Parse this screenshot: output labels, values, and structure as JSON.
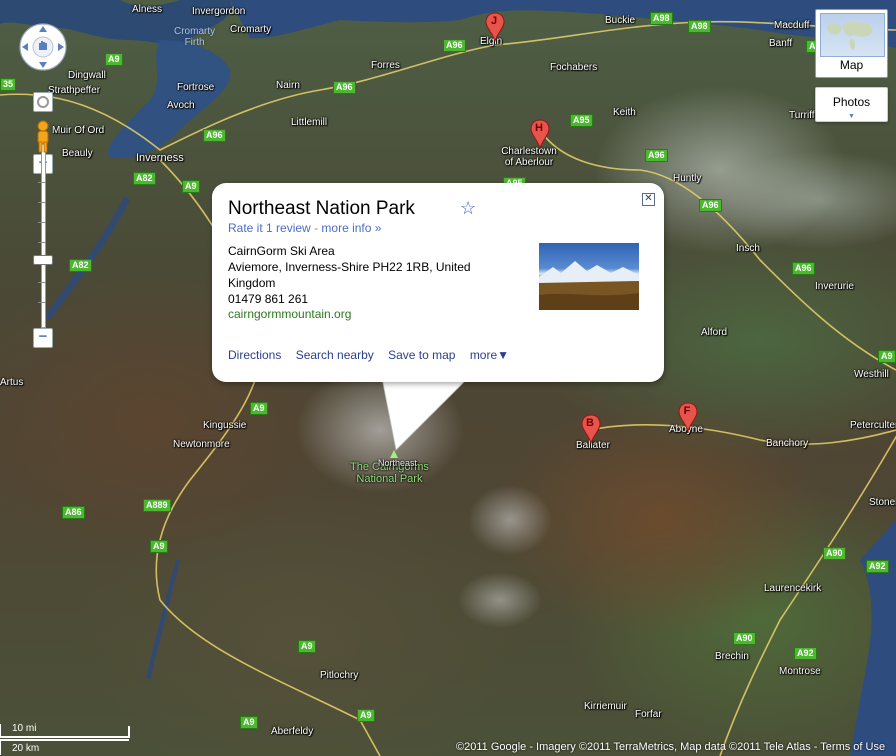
{
  "map": {
    "places": [
      {
        "name": "Alness",
        "pos": "alness"
      },
      {
        "name": "Invergordon",
        "pos": "invergordon"
      },
      {
        "name": "Cromarty",
        "pos": "cromarty"
      },
      {
        "name": "Dingwall",
        "pos": "dingwall"
      },
      {
        "name": "Strathpeffer",
        "pos": "strathpeffer"
      },
      {
        "name": "Fortrose",
        "pos": "fortrose"
      },
      {
        "name": "Avoch",
        "pos": "avoch"
      },
      {
        "name": "Muir Of Ord",
        "pos": "muiroford"
      },
      {
        "name": "Beauly",
        "pos": "beauly"
      },
      {
        "name": "Inverness",
        "pos": "inverness"
      },
      {
        "name": "Nairn",
        "pos": "nairn"
      },
      {
        "name": "Forres",
        "pos": "forres"
      },
      {
        "name": "Littlemill",
        "pos": "littlemill"
      },
      {
        "name": "Elgin",
        "pos": "elgin"
      },
      {
        "name": "Fochabers",
        "pos": "fochabers"
      },
      {
        "name": "Buckie",
        "pos": "buckie"
      },
      {
        "name": "Macduff",
        "pos": "macduff"
      },
      {
        "name": "Banff",
        "pos": "banff"
      },
      {
        "name": "Keith",
        "pos": "keith"
      },
      {
        "name": "Turriff",
        "pos": "turriff"
      },
      {
        "name": "Charlestown of Aberlour",
        "pos": "aberlour"
      },
      {
        "name": "Huntly",
        "pos": "huntly"
      },
      {
        "name": "Insch",
        "pos": "insch"
      },
      {
        "name": "Inverurie",
        "pos": "inverurie"
      },
      {
        "name": "Alford",
        "pos": "alford"
      },
      {
        "name": "Westhill",
        "pos": "westhill"
      },
      {
        "name": "Aboyne",
        "pos": "aboyne"
      },
      {
        "name": "Banchory",
        "pos": "banchory"
      },
      {
        "name": "Peterculter",
        "pos": "peterculter"
      },
      {
        "name": "Kingussie",
        "pos": "kingussie"
      },
      {
        "name": "Newtonmore",
        "pos": "newtonmore"
      },
      {
        "name": "Ballater",
        "pos": "ballater"
      },
      {
        "name": "Stonehaven",
        "pos": "stonehaven"
      },
      {
        "name": "Laurencekirk",
        "pos": "laurencekirk"
      },
      {
        "name": "Brechin",
        "pos": "brechin"
      },
      {
        "name": "Montrose",
        "pos": "montrose"
      },
      {
        "name": "Pitlochry",
        "pos": "pitlochry"
      },
      {
        "name": "Aberfeldy",
        "pos": "aberfeldy"
      },
      {
        "name": "Kirriemuir",
        "pos": "kirriemuir"
      },
      {
        "name": "Forfar",
        "pos": "forfar"
      },
      {
        "name": "Artus",
        "pos": "artus"
      }
    ],
    "water_label": {
      "line1": "Cromarty",
      "line2": "Firth"
    },
    "park_label": {
      "line1": "The Cairngorms",
      "line2": "National Park"
    },
    "park_marker_text": "Northeast",
    "roads": [
      {
        "label": "A9",
        "pos": "r1"
      },
      {
        "label": "A96",
        "pos": "r2"
      },
      {
        "label": "A96",
        "pos": "r3"
      },
      {
        "label": "A96",
        "pos": "r4"
      },
      {
        "label": "A98",
        "pos": "r5"
      },
      {
        "label": "A98",
        "pos": "r6"
      },
      {
        "label": "A95",
        "pos": "r7"
      },
      {
        "label": "A96",
        "pos": "r8"
      },
      {
        "label": "A96",
        "pos": "r9"
      },
      {
        "label": "A96",
        "pos": "r10"
      },
      {
        "label": "A82",
        "pos": "r11"
      },
      {
        "label": "A9",
        "pos": "r12"
      },
      {
        "label": "A82",
        "pos": "r13"
      },
      {
        "label": "A9",
        "pos": "r14"
      },
      {
        "label": "A95",
        "pos": "r15"
      },
      {
        "label": "A86",
        "pos": "r16"
      },
      {
        "label": "A889",
        "pos": "r17"
      },
      {
        "label": "A9",
        "pos": "r18"
      },
      {
        "label": "A9",
        "pos": "r19"
      },
      {
        "label": "A9",
        "pos": "r20"
      },
      {
        "label": "A90",
        "pos": "r21"
      },
      {
        "label": "A92",
        "pos": "r22"
      },
      {
        "label": "A90",
        "pos": "r23"
      },
      {
        "label": "A92",
        "pos": "r24"
      },
      {
        "label": "A9",
        "pos": "r25"
      },
      {
        "label": "A96",
        "pos": "r26"
      },
      {
        "label": "A9",
        "pos": "r27"
      },
      {
        "label": "35",
        "pos": "r28"
      }
    ],
    "markers": [
      {
        "letter": "J",
        "pos": "mj"
      },
      {
        "letter": "H",
        "pos": "mh"
      },
      {
        "letter": "B",
        "pos": "mb"
      },
      {
        "letter": "F",
        "pos": "mf"
      }
    ]
  },
  "controls": {
    "map_type_label": "Map",
    "photos_label": "Photos",
    "zoom_in": "+",
    "zoom_out": "−"
  },
  "info": {
    "title": "Northeast Nation Park",
    "rate_link": "Rate it",
    "review_link": "1 review",
    "separator": "-",
    "more_info_link": "more info »",
    "address_lines": [
      "CairnGorm Ski Area",
      "Aviemore, Inverness-Shire PH22 1RB, United Kingdom",
      "01479 861 261"
    ],
    "website": "cairngormmountain.org",
    "actions": [
      "Directions",
      "Search nearby",
      "Save to map",
      "more▼"
    ]
  },
  "scale": {
    "miles": "10 mi",
    "km": "20 km"
  },
  "copyright": {
    "text": "©2011 Google - Imagery ©2011 TerraMetrics, Map data ©2011 Tele Atlas - ",
    "terms": "Terms of Use"
  }
}
